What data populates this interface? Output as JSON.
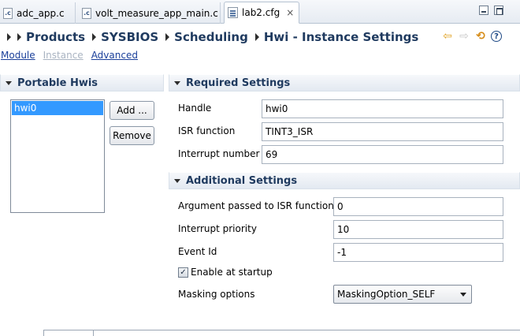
{
  "tabs": [
    {
      "label": "adc_app.c",
      "icon": "c-file-icon",
      "active": false
    },
    {
      "label": "volt_measure_app_main.c",
      "icon": "c-file-icon",
      "active": false
    },
    {
      "label": "lab2.cfg",
      "icon": "cfg-file-icon",
      "active": true,
      "close": "×"
    }
  ],
  "breadcrumb": [
    "Products",
    "SYSBIOS",
    "Scheduling",
    "Hwi - Instance Settings"
  ],
  "toolbar_icons": [
    "back-icon",
    "forward-icon",
    "refresh-icon",
    "help-icon"
  ],
  "toolbar_glyphs": {
    "back": "⇦",
    "forward": "⇨",
    "refresh": "⟲",
    "help": "?"
  },
  "modes": [
    {
      "label": "Module",
      "enabled": true
    },
    {
      "label": "Instance",
      "enabled": false
    },
    {
      "label": "Advanced",
      "enabled": true
    }
  ],
  "portable": {
    "title": "Portable Hwis",
    "items": [
      "hwi0"
    ],
    "add_label": "Add ...",
    "remove_label": "Remove"
  },
  "required": {
    "title": "Required Settings",
    "handle_label": "Handle",
    "handle_value": "hwi0",
    "isr_label": "ISR function",
    "isr_value": "TINT3_ISR",
    "intnum_label": "Interrupt number",
    "intnum_value": "69"
  },
  "additional": {
    "title": "Additional Settings",
    "arg_label": "Argument passed to ISR function",
    "arg_value": "0",
    "priority_label": "Interrupt priority",
    "priority_value": "10",
    "eventid_label": "Event Id",
    "eventid_value": "-1",
    "enable_label": "Enable at startup",
    "enable_checked": true,
    "masking_label": "Masking options",
    "masking_value": "MaskingOption_SELF"
  },
  "colors": {
    "accent": "#1f3a5f",
    "selection": "#3399ff",
    "link": "#1a3f9a"
  }
}
